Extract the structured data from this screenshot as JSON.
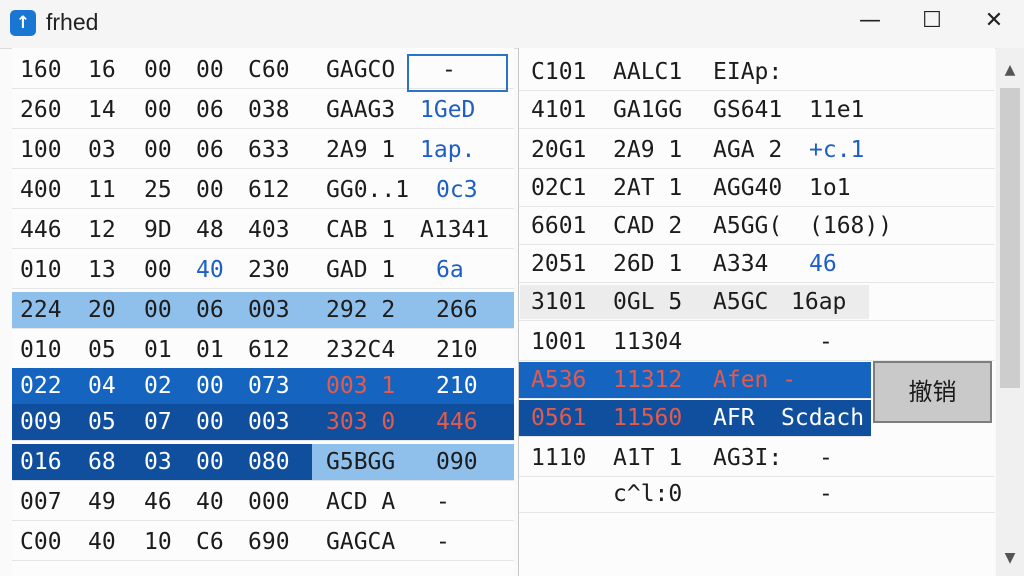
{
  "window": {
    "title": "frhed",
    "app_icon": "arrow-up-icon",
    "controls": {
      "minimize": "—",
      "maximize": "☐",
      "close": "✕"
    }
  },
  "left_pane": {
    "rows": [
      {
        "cells": [
          "160",
          "16",
          "00",
          "00",
          "C60",
          "GAGCO",
          "-"
        ],
        "state": "normal"
      },
      {
        "cells": [
          "260",
          "14",
          "00",
          "06",
          "038",
          "GAAG3",
          "1GeD"
        ],
        "state": "normal"
      },
      {
        "cells": [
          "100",
          "03",
          "00",
          "06",
          "633",
          "2A9 1",
          "1ap."
        ],
        "state": "normal"
      },
      {
        "cells": [
          "400",
          "11",
          "25",
          "00",
          "612",
          "GG0..1",
          "0c3"
        ],
        "state": "normal"
      },
      {
        "cells": [
          "446",
          "12",
          "9D",
          "48",
          "403",
          "CAB 1",
          "A1341"
        ],
        "state": "normal"
      },
      {
        "cells": [
          "010",
          "13",
          "00",
          "40",
          "230",
          "GAD 1",
          "6a"
        ],
        "state": "normal"
      },
      {
        "cells": [
          "224",
          "20",
          "00",
          "06",
          "003",
          "292 2",
          "266"
        ],
        "state": "sel-light"
      },
      {
        "cells": [
          "010",
          "05",
          "01",
          "01",
          "612",
          "232C4",
          "210"
        ],
        "state": "normal"
      },
      {
        "cells": [
          "022",
          "04",
          "02",
          "00",
          "073",
          "003 1",
          "210"
        ],
        "state": "sel-dark"
      },
      {
        "cells": [
          "009",
          "05",
          "07",
          "00",
          "003",
          "303 0",
          "446"
        ],
        "state": "sel-darker"
      },
      {
        "cells": [
          "016",
          "68",
          "03",
          "00",
          "080",
          "G5BGG",
          "090"
        ],
        "state": "sel-mixed"
      },
      {
        "cells": [
          "007",
          "49",
          "46",
          "40",
          "000",
          "ACD A",
          "-"
        ],
        "state": "normal"
      },
      {
        "cells": [
          "C00",
          "40",
          "10",
          "C6",
          "690",
          "GAGCA",
          "-"
        ],
        "state": "normal"
      }
    ]
  },
  "right_pane": {
    "rows": [
      {
        "cells": [
          "C101",
          "AALC1",
          "EIAp:",
          ""
        ],
        "state": "normal"
      },
      {
        "cells": [
          "4101",
          "GA1GG",
          "GS641",
          "11e1"
        ],
        "state": "normal"
      },
      {
        "cells": [
          "20G1",
          "2A9 1",
          "AGA 2",
          "+c.1"
        ],
        "state": "normal"
      },
      {
        "cells": [
          "02C1",
          "2AT 1",
          "AGG40",
          "1o1"
        ],
        "state": "normal"
      },
      {
        "cells": [
          "6601",
          "CAD 2",
          "A5GG(",
          "(168))"
        ],
        "state": "normal"
      },
      {
        "cells": [
          "2051",
          "26D 1",
          "A334",
          "46"
        ],
        "state": "normal"
      },
      {
        "cells": [
          "3101",
          "0GL 5",
          "A5GC",
          "16ap"
        ],
        "state": "focus"
      },
      {
        "cells": [
          "1001",
          "11304",
          "",
          "-"
        ],
        "state": "normal"
      },
      {
        "cells": [
          "A536",
          "11312",
          "Afen -",
          ""
        ],
        "state": "sel-dark"
      },
      {
        "cells": [
          "0561",
          "11560",
          "AFR",
          "Scdach"
        ],
        "state": "sel-darker"
      },
      {
        "cells": [
          "1110",
          "A1T 1",
          "AG3I:",
          "-"
        ],
        "state": "normal"
      },
      {
        "cells": [
          "",
          "c^l:0",
          "",
          "-"
        ],
        "state": "normal"
      }
    ]
  },
  "context_button": {
    "label": "撤销"
  },
  "scrollbar": {
    "up": "▲",
    "down": "▼"
  },
  "colors": {
    "selection_light": "#8fc0ec",
    "selection_dark": "#1565c0",
    "selection_darker": "#0f4f9e",
    "accent_blue_text": "#1d5fc4",
    "accent_red_text": "#e25b4c"
  }
}
